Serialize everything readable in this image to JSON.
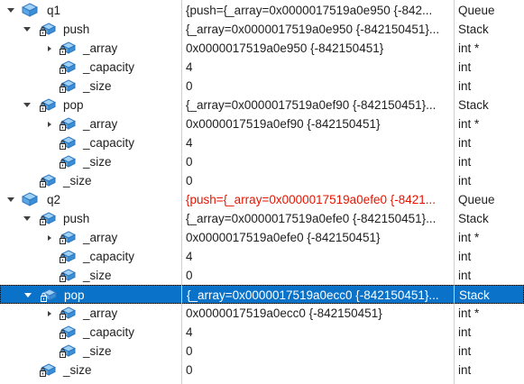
{
  "colors": {
    "selection_bg": "#0a72c8",
    "changed_value": "#e51400",
    "grid_line": "#d0d0d0",
    "icon_blue": "#3b8fd6"
  },
  "rows": [
    {
      "name": "q1",
      "value": "{push={_array=0x0000017519a0e950 {-842...",
      "type": "Queue",
      "expander": "expanded",
      "icon": "object-icon",
      "changed": false,
      "selected": false
    },
    {
      "name": "push",
      "value": "{_array=0x0000017519a0e950 {-842150451}...",
      "type": "Stack",
      "expander": "expanded",
      "icon": "locked-member-icon",
      "changed": false,
      "selected": false
    },
    {
      "name": "_array",
      "value": "0x0000017519a0e950 {-842150451}",
      "type": "int *",
      "expander": "collapsed",
      "icon": "locked-member-icon",
      "changed": false,
      "selected": false
    },
    {
      "name": "_capacity",
      "value": "4",
      "type": "int",
      "expander": "none",
      "icon": "locked-member-icon",
      "changed": false,
      "selected": false
    },
    {
      "name": "_size",
      "value": "0",
      "type": "int",
      "expander": "none",
      "icon": "locked-member-icon",
      "changed": false,
      "selected": false
    },
    {
      "name": "pop",
      "value": "{_array=0x0000017519a0ef90 {-842150451}...",
      "type": "Stack",
      "expander": "expanded",
      "icon": "locked-member-icon",
      "changed": false,
      "selected": false
    },
    {
      "name": "_array",
      "value": "0x0000017519a0ef90 {-842150451}",
      "type": "int *",
      "expander": "collapsed",
      "icon": "locked-member-icon",
      "changed": false,
      "selected": false
    },
    {
      "name": "_capacity",
      "value": "4",
      "type": "int",
      "expander": "none",
      "icon": "locked-member-icon",
      "changed": false,
      "selected": false
    },
    {
      "name": "_size",
      "value": "0",
      "type": "int",
      "expander": "none",
      "icon": "locked-member-icon",
      "changed": false,
      "selected": false
    },
    {
      "name": "_size",
      "value": "0",
      "type": "int",
      "expander": "none",
      "icon": "locked-member-icon",
      "changed": false,
      "selected": false
    },
    {
      "name": "q2",
      "value": "{push={_array=0x0000017519a0efe0 {-8421...",
      "type": "Queue",
      "expander": "expanded",
      "icon": "object-icon",
      "changed": true,
      "selected": false
    },
    {
      "name": "push",
      "value": "{_array=0x0000017519a0efe0 {-842150451}...",
      "type": "Stack",
      "expander": "expanded",
      "icon": "locked-member-icon",
      "changed": false,
      "selected": false
    },
    {
      "name": "_array",
      "value": "0x0000017519a0efe0 {-842150451}",
      "type": "int *",
      "expander": "collapsed",
      "icon": "locked-member-icon",
      "changed": false,
      "selected": false
    },
    {
      "name": "_capacity",
      "value": "4",
      "type": "int",
      "expander": "none",
      "icon": "locked-member-icon",
      "changed": false,
      "selected": false
    },
    {
      "name": "_size",
      "value": "0",
      "type": "int",
      "expander": "none",
      "icon": "locked-member-icon",
      "changed": false,
      "selected": false
    },
    {
      "name": "pop",
      "value": "{_array=0x0000017519a0ecc0 {-842150451}...",
      "type": "Stack",
      "expander": "expanded",
      "icon": "locked-member-icon",
      "changed": false,
      "selected": true
    },
    {
      "name": "_array",
      "value": "0x0000017519a0ecc0 {-842150451}",
      "type": "int *",
      "expander": "collapsed",
      "icon": "locked-member-icon",
      "changed": false,
      "selected": false
    },
    {
      "name": "_capacity",
      "value": "4",
      "type": "int",
      "expander": "none",
      "icon": "locked-member-icon",
      "changed": false,
      "selected": false
    },
    {
      "name": "_size",
      "value": "0",
      "type": "int",
      "expander": "none",
      "icon": "locked-member-icon",
      "changed": false,
      "selected": false
    },
    {
      "name": "_size",
      "value": "0",
      "type": "int",
      "expander": "none",
      "icon": "locked-member-icon",
      "changed": false,
      "selected": false
    }
  ]
}
